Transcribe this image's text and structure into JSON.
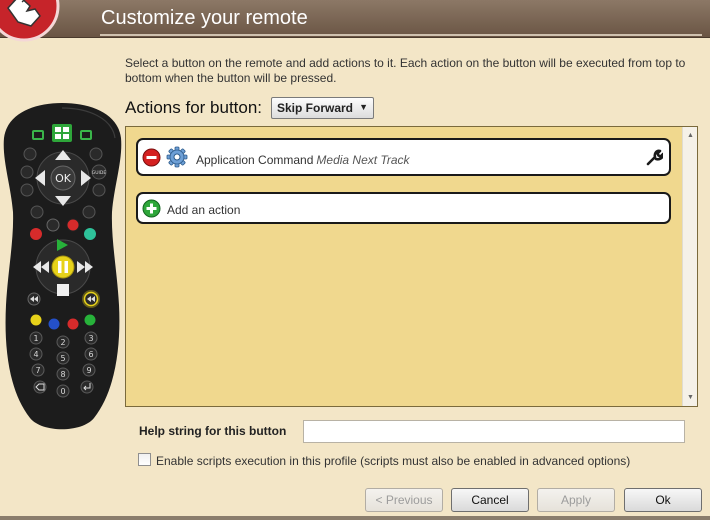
{
  "window": {
    "title": "Customize your remote"
  },
  "description": "Select a button on the remote and add actions to it. Each action on the button will be executed from top to bottom when the button will be pressed.",
  "actions_for_button": {
    "label": "Actions for button:",
    "selected": "Skip Forward"
  },
  "actions": [
    {
      "name": "Application Command",
      "parameter": "Media Next Track"
    }
  ],
  "add_action_label": "Add an action",
  "help_string": {
    "label": "Help string for this button",
    "value": ""
  },
  "scripts_checkbox": {
    "label": "Enable scripts execution in this profile (scripts must also be enabled in advanced options)",
    "checked": false
  },
  "buttons": {
    "previous": "< Previous",
    "cancel": "Cancel",
    "apply": "Apply",
    "ok": "Ok"
  },
  "remote": {
    "ok_label": "OK",
    "guide_label": "GUIDE",
    "digits": [
      "1",
      "2",
      "3",
      "4",
      "5",
      "6",
      "7",
      "8",
      "9",
      "0"
    ],
    "selected_button": "Skip Forward"
  },
  "colors": {
    "header": "#7e6a58",
    "background": "#f3e6c7",
    "action_panel": "#f0d88e",
    "remote_body": "#1c1c1c",
    "remote_glyph": "#d8d8d8",
    "remote_green": "#27b23a",
    "remote_yellow": "#e7d21a",
    "remote_red": "#d62b2b",
    "remote_blue": "#2450c8",
    "remove_icon": "#d42020",
    "add_icon": "#2ea63a"
  },
  "icons": [
    "hand-pointer-icon",
    "remove-icon",
    "gear-icon",
    "wrench-icon",
    "add-icon",
    "dropdown-arrow-icon"
  ]
}
